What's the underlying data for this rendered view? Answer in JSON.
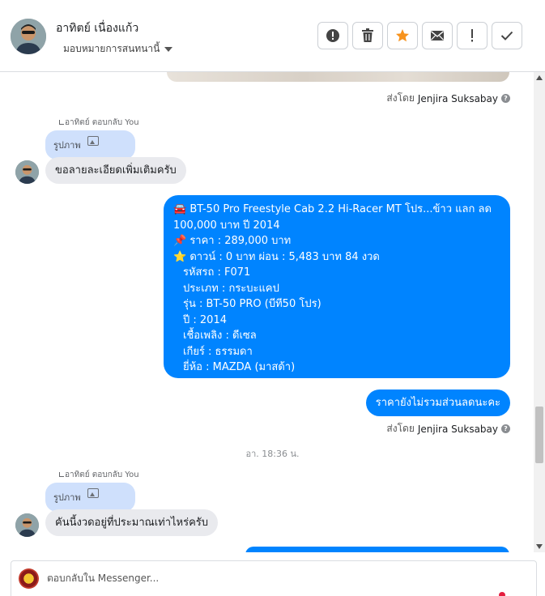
{
  "header": {
    "name": "อาทิตย์ เนื่องแก้ว",
    "assign_label": "มอบหมายการสนทนานี้"
  },
  "toolbar": {
    "buttons": [
      {
        "icon": "alert-circle-icon"
      },
      {
        "icon": "trash-icon"
      },
      {
        "icon": "star-icon",
        "color": "#f7931e"
      },
      {
        "icon": "envelope-icon"
      },
      {
        "icon": "exclamation-icon"
      },
      {
        "icon": "check-icon"
      }
    ]
  },
  "messages": {
    "sent_by_prefix": "ส่งโดย",
    "sent_by_name": "Jenjira Suksabay",
    "reply_note": "อาทิตย์ ตอบกลับ You",
    "image_label": "รูปภาพ",
    "incoming_1": "ขอลายละเอียดเพิ่มเติมครับ",
    "listing": {
      "line1": "🚘 BT-50 Pro Freestyle Cab 2.2 Hi-Racer MT โปร...ข้าว แลก ลด",
      "line2": "100,000 บาท ปี 2014",
      "line3": "📌 ราคา : 289,000 บาท",
      "line4": "⭐ ดาวน์ : 0 บาท ผ่อน : 5,483 บาท 84 งวด",
      "line5": "รหัสรถ : F071",
      "line6": "ประเภท : กระบะแคป",
      "line7": "รุ่น : BT-50 PRO (บีที50 โปร)",
      "line8": "ปี : 2014",
      "line9": "เชื้อเพลิง : ดีเซล",
      "line10": "เกียร์ : ธรรมดา",
      "line11": "ยี่ห้อ : MAZDA (มาสด้า)"
    },
    "outgoing_note": "ราคายังไม่รวมส่วนลดนะคะ",
    "timestamp": "อา. 18:36 น.",
    "incoming_2": "คันนี้งวดอยู่ที่ประมาณเท่าไหร่ครับ"
  },
  "composer": {
    "placeholder": "ตอบกลับใน Messenger..."
  },
  "colors": {
    "outgoing_bubble": "#0084ff",
    "incoming_bubble": "#e9eaee",
    "reply_bubble": "#cfe0fc"
  }
}
